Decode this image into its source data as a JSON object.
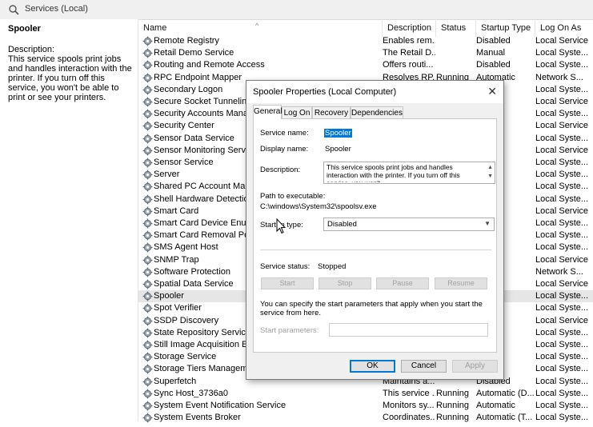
{
  "window": {
    "title": "Services (Local)"
  },
  "left_pane": {
    "service_name": "Spooler",
    "description_heading": "Description:",
    "description_text": "This service spools print jobs and handles interaction with the printer. If you turn off this service, you won't be able to print or see your printers."
  },
  "columns": {
    "name": "Name",
    "description": "Description",
    "status": "Status",
    "startup_type": "Startup Type",
    "log_on_as": "Log On As"
  },
  "services": [
    {
      "name": "Remote Registry",
      "description": "Enables rem...",
      "status": "",
      "startup": "Disabled",
      "logon": "Local Service"
    },
    {
      "name": "Retail Demo Service",
      "description": "The Retail D...",
      "status": "",
      "startup": "Manual",
      "logon": "Local Syste..."
    },
    {
      "name": "Routing and Remote Access",
      "description": "Offers routi...",
      "status": "",
      "startup": "Disabled",
      "logon": "Local Syste..."
    },
    {
      "name": "RPC Endpoint Mapper",
      "description": "Resolves RP...",
      "status": "Running",
      "startup": "Automatic",
      "logon": "Network S..."
    },
    {
      "name": "Secondary Logon",
      "description": "",
      "status": "",
      "startup": "",
      "logon": "Local Syste..."
    },
    {
      "name": "Secure Socket Tunneling Pr",
      "description": "",
      "status": "",
      "startup": "",
      "logon": "Local Service"
    },
    {
      "name": "Security Accounts Manager",
      "description": "",
      "status": "",
      "startup": "tic",
      "logon": "Local Syste..."
    },
    {
      "name": "Security Center",
      "description": "",
      "status": "",
      "startup": "tic (D...",
      "logon": "Local Service"
    },
    {
      "name": "Sensor Data Service",
      "description": "",
      "status": "",
      "startup": "(Trig...",
      "logon": "Local Syste..."
    },
    {
      "name": "Sensor Monitoring Service",
      "description": "",
      "status": "",
      "startup": "(Trig...",
      "logon": "Local Service"
    },
    {
      "name": "Sensor Service",
      "description": "",
      "status": "",
      "startup": "(Trig...",
      "logon": "Local Syste..."
    },
    {
      "name": "Server",
      "description": "",
      "status": "",
      "startup": "tic (T...",
      "logon": "Local Syste..."
    },
    {
      "name": "Shared PC Account Manage",
      "description": "",
      "status": "",
      "startup": "d",
      "logon": "Local Syste..."
    },
    {
      "name": "Shell Hardware Detection",
      "description": "",
      "status": "",
      "startup": "tic",
      "logon": "Local Syste..."
    },
    {
      "name": "Smart Card",
      "description": "",
      "status": "",
      "startup": "",
      "logon": "Local Service"
    },
    {
      "name": "Smart Card Device Enumera",
      "description": "",
      "status": "",
      "startup": "(Trig...",
      "logon": "Local Syste..."
    },
    {
      "name": "Smart Card Removal Policy",
      "description": "",
      "status": "",
      "startup": "",
      "logon": "Local Syste..."
    },
    {
      "name": "SMS Agent Host",
      "description": "",
      "status": "",
      "startup": "tic (D...",
      "logon": "Local Syste..."
    },
    {
      "name": "SNMP Trap",
      "description": "",
      "status": "",
      "startup": "",
      "logon": "Local Service"
    },
    {
      "name": "Software Protection",
      "description": "",
      "status": "",
      "startup": "tic (D...",
      "logon": "Network S..."
    },
    {
      "name": "Spatial Data Service",
      "description": "",
      "status": "",
      "startup": "",
      "logon": "Local Service"
    },
    {
      "name": "Spooler",
      "description": "",
      "status": "",
      "startup": "d",
      "logon": "Local Syste..."
    },
    {
      "name": "Spot Verifier",
      "description": "",
      "status": "",
      "startup": "(Trig...",
      "logon": "Local Syste..."
    },
    {
      "name": "SSDP Discovery",
      "description": "",
      "status": "",
      "startup": "",
      "logon": "Local Service"
    },
    {
      "name": "State Repository Service",
      "description": "",
      "status": "",
      "startup": "",
      "logon": "Local Syste..."
    },
    {
      "name": "Still Image Acquisition Ever",
      "description": "",
      "status": "",
      "startup": "",
      "logon": "Local Syste..."
    },
    {
      "name": "Storage Service",
      "description": "",
      "status": "",
      "startup": "(Trig...",
      "logon": "Local Syste..."
    },
    {
      "name": "Storage Tiers Management",
      "description": "",
      "status": "",
      "startup": "",
      "logon": "Local Syste..."
    },
    {
      "name": "Superfetch",
      "description": "Maintains a...",
      "status": "",
      "startup": "Disabled",
      "logon": "Local Syste..."
    },
    {
      "name": "Sync Host_3736a0",
      "description": "This service ...",
      "status": "Running",
      "startup": "Automatic (D...",
      "logon": "Local Syste..."
    },
    {
      "name": "System Event Notification Service",
      "description": "Monitors sy...",
      "status": "Running",
      "startup": "Automatic",
      "logon": "Local Syste..."
    },
    {
      "name": "System Events Broker",
      "description": "Coordinates...",
      "status": "Running",
      "startup": "Automatic (T...",
      "logon": "Local Syste..."
    }
  ],
  "selected_index": 21,
  "dialog": {
    "title": "Spooler Properties (Local Computer)",
    "tabs": [
      "General",
      "Log On",
      "Recovery",
      "Dependencies"
    ],
    "service_name_label": "Service name:",
    "service_name_value": "Spooler",
    "display_name_label": "Display name:",
    "display_name_value": "Spooler",
    "description_label": "Description:",
    "description_value": "This service spools print jobs and handles interaction with the printer.  If you turn off this service, you won't",
    "path_label": "Path to executable:",
    "path_value": "C:\\windows\\System32\\spoolsv.exe",
    "startup_type_label": "Startup type:",
    "startup_type_value": "Disabled",
    "service_status_label": "Service status:",
    "service_status_value": "Stopped",
    "start_label": "Start",
    "stop_label": "Stop",
    "pause_label": "Pause",
    "resume_label": "Resume",
    "hint_text": "You can specify the start parameters that apply when you start the service from here.",
    "start_params_label": "Start parameters:",
    "ok_label": "OK",
    "cancel_label": "Cancel",
    "apply_label": "Apply"
  }
}
